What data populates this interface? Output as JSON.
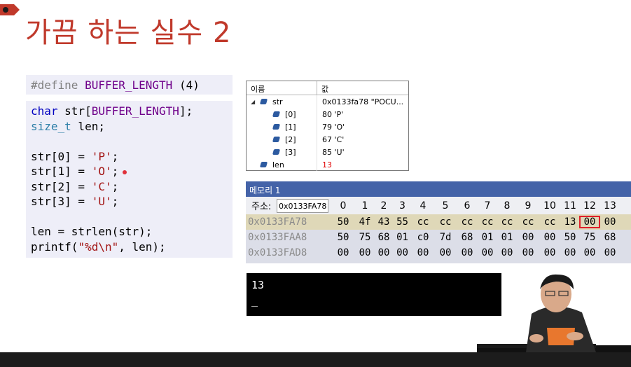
{
  "slide": {
    "title": "가끔 하는 실수 2"
  },
  "code": {
    "define_directive": "#define",
    "define_name": "BUFFER_LENGTH",
    "define_value": " (4)",
    "lines": [
      [
        {
          "t": "kw",
          "v": "char"
        },
        {
          "t": "n",
          "v": " str["
        },
        {
          "t": "mac",
          "v": "BUFFER_LENGTH"
        },
        {
          "t": "n",
          "v": "];"
        }
      ],
      [
        {
          "t": "tp",
          "v": "size_t"
        },
        {
          "t": "n",
          "v": " len;"
        }
      ],
      [],
      [
        {
          "t": "n",
          "v": "str[0] = "
        },
        {
          "t": "str",
          "v": "'P'"
        },
        {
          "t": "n",
          "v": ";"
        }
      ],
      [
        {
          "t": "n",
          "v": "str[1] = "
        },
        {
          "t": "str",
          "v": "'O'"
        },
        {
          "t": "n",
          "v": ";"
        }
      ],
      [
        {
          "t": "n",
          "v": "str[2] = "
        },
        {
          "t": "str",
          "v": "'C'"
        },
        {
          "t": "n",
          "v": ";"
        }
      ],
      [
        {
          "t": "n",
          "v": "str[3] = "
        },
        {
          "t": "str",
          "v": "'U'"
        },
        {
          "t": "n",
          "v": ";"
        }
      ],
      [],
      [
        {
          "t": "n",
          "v": "len = strlen(str);"
        }
      ],
      [
        {
          "t": "n",
          "v": "printf("
        },
        {
          "t": "str",
          "v": "\"%d\\n\""
        },
        {
          "t": "n",
          "v": ", len);"
        }
      ]
    ],
    "breakpoint_line": 4
  },
  "watch": {
    "col_name": "이름",
    "col_value": "값",
    "rows": [
      {
        "name": "str",
        "value": "0x0133fa78 \"POCU...",
        "expanded": true,
        "indent": false,
        "changed": false
      },
      {
        "name": "[0]",
        "value": "80 'P'",
        "indent": true,
        "changed": false
      },
      {
        "name": "[1]",
        "value": "79 'O'",
        "indent": true,
        "changed": false
      },
      {
        "name": "[2]",
        "value": "67 'C'",
        "indent": true,
        "changed": false
      },
      {
        "name": "[3]",
        "value": "85 'U'",
        "indent": true,
        "changed": false
      },
      {
        "name": "len",
        "value": "13",
        "indent": false,
        "changed": true
      }
    ]
  },
  "memory": {
    "title": "메모리 1",
    "address_label": "주소:",
    "address_value": "0x0133FA78",
    "columns": [
      "0",
      "1",
      "2",
      "3",
      "4",
      "5",
      "6",
      "7",
      "8",
      "9",
      "10",
      "11",
      "12",
      "13"
    ],
    "rows": [
      {
        "addr": "0x0133FA78",
        "bytes": [
          "50",
          "4f",
          "43",
          "55",
          "cc",
          "cc",
          "cc",
          "cc",
          "cc",
          "cc",
          "cc",
          "13",
          "00",
          "00"
        ],
        "highlight_index": 12
      },
      {
        "addr": "0x0133FAA8",
        "bytes": [
          "50",
          "75",
          "68",
          "01",
          "c0",
          "7d",
          "68",
          "01",
          "01",
          "00",
          "00",
          "50",
          "75",
          "68"
        ],
        "highlight_index": -1
      },
      {
        "addr": "0x0133FAD8",
        "bytes": [
          "00",
          "00",
          "00",
          "00",
          "00",
          "00",
          "00",
          "00",
          "00",
          "00",
          "00",
          "00",
          "00",
          "00"
        ],
        "highlight_index": -1
      }
    ]
  },
  "console": {
    "output": "13",
    "cursor": "_"
  },
  "colors": {
    "title": "#c0392b",
    "memory_titlebar": "#4463a8",
    "highlight_box": "#e0202a"
  }
}
